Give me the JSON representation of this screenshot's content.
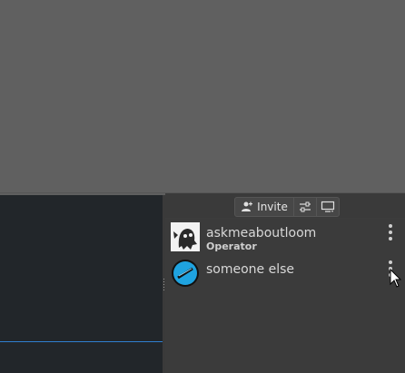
{
  "toolbar": {
    "invite_label": "Invite",
    "invite_icon": "add-user-icon",
    "settings_icon": "sliders-icon",
    "screen_icon": "monitor-icon"
  },
  "members": [
    {
      "name": "askmeaboutloom",
      "role": "Operator",
      "avatar": "ghost-avatar-icon"
    },
    {
      "name": "someone else",
      "role": "",
      "avatar": "blue-circle-avatar-icon"
    }
  ],
  "colors": {
    "canvas": "#606060",
    "left_panel": "#22262a",
    "accent_line": "#2f7fd0",
    "avatar_blue": "#1fa3e0"
  }
}
